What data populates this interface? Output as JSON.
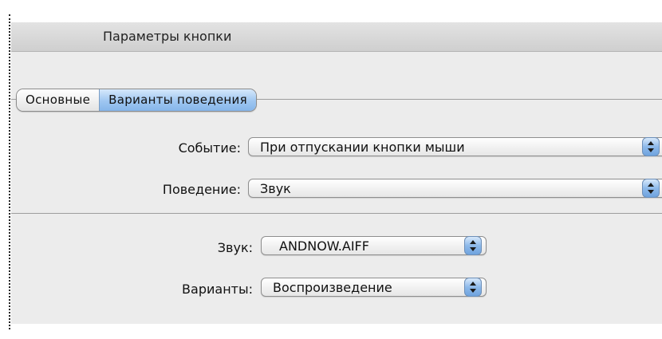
{
  "window": {
    "title": "Параметры кнопки"
  },
  "tabs": [
    {
      "label": "Основные",
      "active": false
    },
    {
      "label": "Варианты поведения",
      "active": true
    }
  ],
  "event": {
    "label": "Событие:",
    "value": "При отпускании кнопки мыши"
  },
  "behavior": {
    "label": "Поведение:",
    "value": "Звук"
  },
  "sound": {
    "label": "Звук:",
    "value": "ANDNOW.AIFF"
  },
  "options": {
    "label": "Варианты:",
    "value": "Воспроизведение"
  },
  "colors": {
    "accent": "#86b6ea",
    "panel": "#ececec"
  },
  "icons": {
    "popup_arrows": "up-down-arrows-icon"
  }
}
